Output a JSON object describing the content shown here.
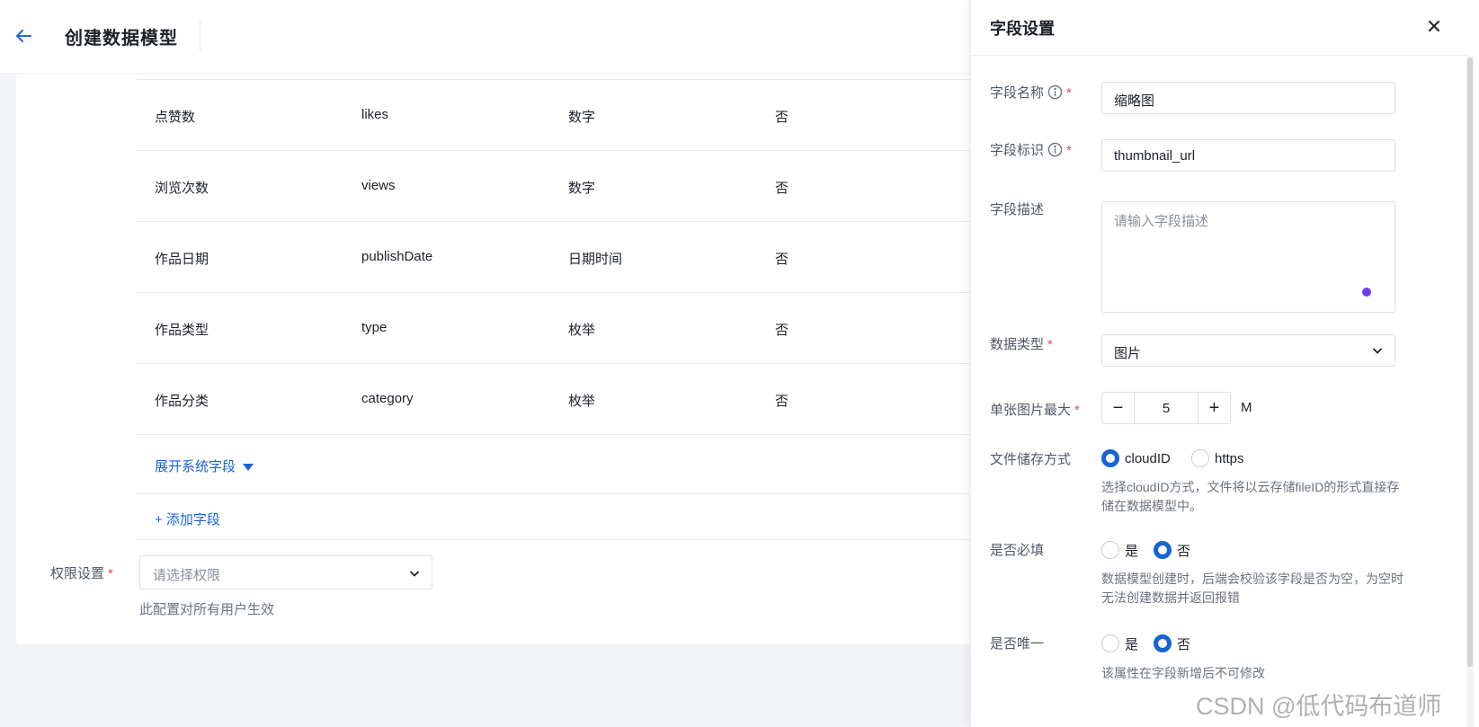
{
  "header": {
    "title": "创建数据模型"
  },
  "fields_table": {
    "rows": [
      {
        "name": "点赞数",
        "key": "likes",
        "type": "数字",
        "required": "否"
      },
      {
        "name": "浏览次数",
        "key": "views",
        "type": "数字",
        "required": "否"
      },
      {
        "name": "作品日期",
        "key": "publishDate",
        "type": "日期时间",
        "required": "否"
      },
      {
        "name": "作品类型",
        "key": "type",
        "type": "枚举",
        "required": "否"
      },
      {
        "name": "作品分类",
        "key": "category",
        "type": "枚举",
        "required": "否"
      }
    ],
    "expand_label": "展开系统字段",
    "add_label": "+ 添加字段"
  },
  "permission": {
    "label": "权限设置",
    "required_mark": "*",
    "placeholder": "请选择权限",
    "hint": "此配置对所有用户生效"
  },
  "drawer": {
    "title": "字段设置",
    "field_name": {
      "label": "字段名称",
      "value": "缩略图"
    },
    "field_key": {
      "label": "字段标识",
      "value": "thumbnail_url"
    },
    "field_desc": {
      "label": "字段描述",
      "placeholder": "请输入字段描述"
    },
    "data_type": {
      "label": "数据类型",
      "value": "图片"
    },
    "max_size": {
      "label": "单张图片最大",
      "value": "5",
      "unit": "M",
      "minus": "−",
      "plus": "+"
    },
    "storage": {
      "label": "文件储存方式",
      "options": [
        "cloudID",
        "https"
      ],
      "selected": "cloudID",
      "help": "选择cloudID方式，文件将以云存储fileID的形式直接存储在数据模型中。"
    },
    "required": {
      "label": "是否必填",
      "options": [
        "是",
        "否"
      ],
      "selected": "否",
      "help": "数据模型创建时，后端会校验该字段是否为空，为空时无法创建数据并返回报错"
    },
    "unique": {
      "label": "是否唯一",
      "options": [
        "是",
        "否"
      ],
      "selected": "否",
      "help": "该属性在字段新增后不可修改"
    },
    "required_mark": "*"
  },
  "watermark": "CSDN @低代码布道师",
  "colors": {
    "accent": "#1664d4",
    "required": "#e34d59"
  }
}
